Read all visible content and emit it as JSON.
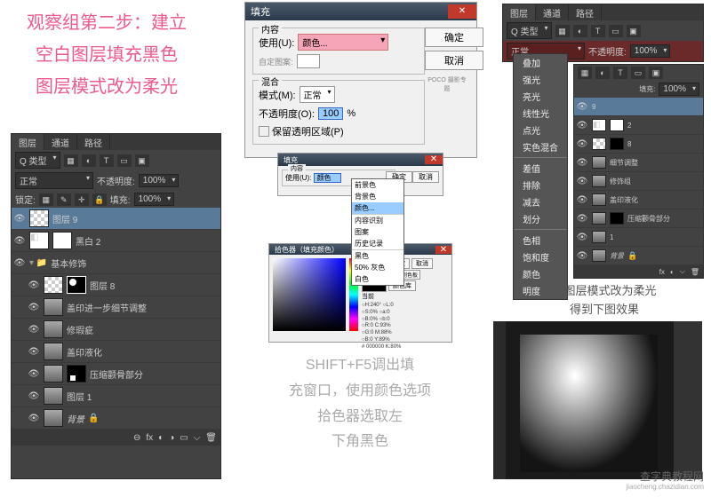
{
  "title": {
    "line1": "观察组第二步：建立",
    "line2": "空白图层填充黑色",
    "line3": "图层模式改为柔光"
  },
  "layers_left": {
    "tabs": [
      "图层",
      "通道",
      "路径"
    ],
    "kind": "Q 类型",
    "kind_icons": [
      "⬚",
      "◯",
      "T",
      "▭",
      "🖼"
    ],
    "mode": "正常",
    "opacity_label": "不透明度:",
    "opacity": "100%",
    "lock_label": "锁定:",
    "lock_icons": [
      "▦",
      "✎",
      "✛",
      "🔒"
    ],
    "fill_label": "填充:",
    "fill": "100%",
    "items": [
      {
        "name": "图层 9",
        "thumb": "checker",
        "sel": true
      },
      {
        "name": "黑白 2",
        "thumb": "adj"
      },
      {
        "name": "基本修饰",
        "folder": true
      },
      {
        "name": "图层 8",
        "thumb": "checker",
        "mask": true
      },
      {
        "name": "盖印进一步细节调整",
        "thumb": "face"
      },
      {
        "name": "修瑕疵",
        "thumb": "face"
      },
      {
        "name": "盖印液化",
        "thumb": "face"
      },
      {
        "name": "压缩颧骨部分",
        "thumb": "face",
        "mask": "blk"
      },
      {
        "name": "图层 1",
        "thumb": "face"
      },
      {
        "name": "背景",
        "thumb": "face",
        "lock": true
      }
    ],
    "footer": [
      "⊖",
      "fx",
      "◐",
      "◑",
      "▭",
      "⌵",
      "🗑"
    ]
  },
  "fill_dialog": {
    "title": "填充",
    "section1": "内容",
    "use_label": "使用(U):",
    "use_value": "颜色...",
    "custom_label": "自定图案:",
    "section2": "混合",
    "mode_label": "模式(M):",
    "mode_value": "正常",
    "opacity_label": "不透明度(O):",
    "opacity_value": "100",
    "percent": "%",
    "preserve": "保留透明区域(P)",
    "ok": "确定",
    "cancel": "取消",
    "logo": "POCO 摄影专题"
  },
  "small_fill": {
    "title": "填充",
    "content": "内容",
    "use": "使用(U):",
    "use_val": "颜色",
    "opts": [
      "前景色",
      "背景色",
      "颜色...",
      "—",
      "内容识别",
      "图案",
      "历史记录",
      "—",
      "黑色",
      "50% 灰色",
      "白色"
    ],
    "ok": "确定",
    "cancel": "取消"
  },
  "picker": {
    "title": "拾色器（填充颜色）",
    "new": "新的",
    "cur": "当前",
    "ok": "确定",
    "cancel": "取消",
    "add": "添加到色板",
    "lib": "颜色库"
  },
  "layers_right": {
    "tabs": [
      "图层",
      "通道",
      "路径"
    ],
    "kind": "Q 类型",
    "mode": "正常",
    "opacity_label": "不透明度:",
    "opacity": "100%",
    "fill_label": "填充:",
    "fill": "100%",
    "mode_menu": [
      "叠加",
      "强光",
      "亮光",
      "线性光",
      "点光",
      "实色混合",
      "—",
      "差值",
      "排除",
      "减去",
      "划分",
      "—",
      "色相",
      "饱和度",
      "颜色",
      "明度"
    ],
    "extra_items": [
      "细节调整",
      "修饰组",
      "盖印液化",
      "压缩颧骨部分",
      "背景"
    ]
  },
  "notes": {
    "shift": "SHIFT+F5调出填",
    "shift2": "充窗口，使用颜色选项",
    "shift3": "拾色器选取左",
    "shift4": "下角黑色",
    "right1": "将图层模式改为柔光",
    "right2": "得到下图效果"
  },
  "watermark": {
    "line1": "查字典教程网",
    "line2": "jiaocheng.chazidian.com"
  }
}
